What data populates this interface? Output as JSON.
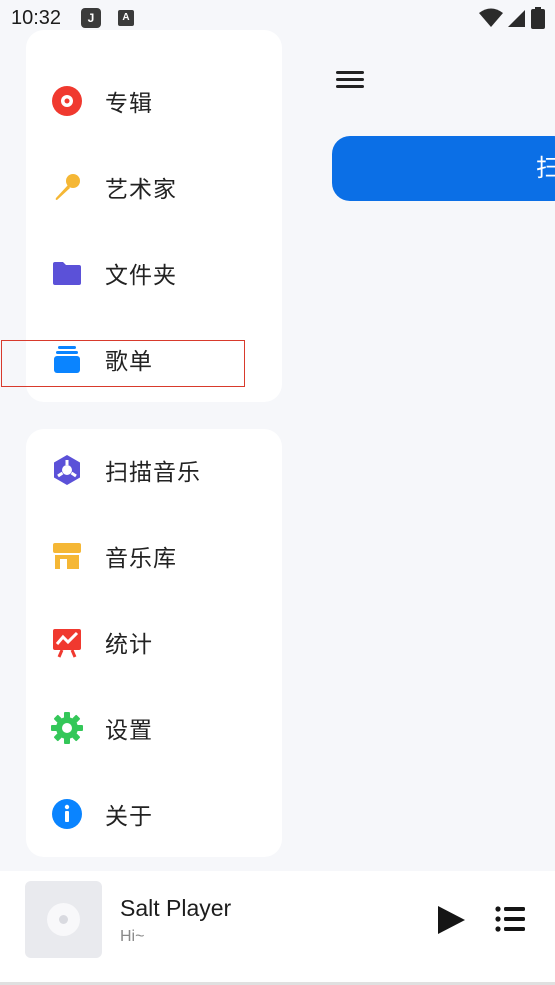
{
  "status_bar": {
    "time": "10:32",
    "notif_1": "J",
    "notif_2": "A"
  },
  "main": {
    "scan_button_label": "扫"
  },
  "drawer": {
    "group_1": [
      {
        "label": "专辑",
        "icon": "album-icon",
        "color": "#f0392f"
      },
      {
        "label": "艺术家",
        "icon": "microphone-icon",
        "color": "#f5b735"
      },
      {
        "label": "文件夹",
        "icon": "folder-icon",
        "color": "#5b51d8"
      },
      {
        "label": "歌单",
        "icon": "playlist-icon",
        "color": "#0a84ff"
      }
    ],
    "group_2": [
      {
        "label": "扫描音乐",
        "icon": "scan-icon",
        "color": "#5b51d8"
      },
      {
        "label": "音乐库",
        "icon": "store-icon",
        "color": "#f5b735"
      },
      {
        "label": "统计",
        "icon": "chart-icon",
        "color": "#f0392f"
      },
      {
        "label": "设置",
        "icon": "gear-icon",
        "color": "#34c759"
      },
      {
        "label": "关于",
        "icon": "info-icon",
        "color": "#0a84ff"
      }
    ]
  },
  "player": {
    "title": "Salt Player",
    "subtitle": "Hi~"
  },
  "highlight_color": "#d83a2c"
}
